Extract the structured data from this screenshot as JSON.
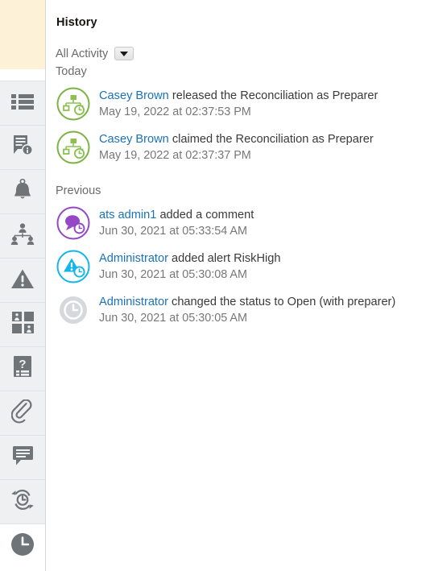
{
  "rail": {
    "items": [
      {
        "name": "properties-list",
        "icon": "list-icon",
        "active": false
      },
      {
        "name": "instructions",
        "icon": "document-info-icon",
        "active": false
      },
      {
        "name": "alerts-bell",
        "icon": "bell-icon",
        "active": false
      },
      {
        "name": "workflow-users",
        "icon": "org-chart-icon",
        "active": false
      },
      {
        "name": "warnings",
        "icon": "warning-triangle-icon",
        "active": false
      },
      {
        "name": "viewers",
        "icon": "people-grid-icon",
        "active": false
      },
      {
        "name": "questions",
        "icon": "question-document-icon",
        "active": false
      },
      {
        "name": "attachments",
        "icon": "paperclip-icon",
        "active": false
      },
      {
        "name": "comments",
        "icon": "speech-bubble-icon",
        "active": false
      },
      {
        "name": "reassign",
        "icon": "refresh-clock-icon",
        "active": false
      },
      {
        "name": "history",
        "icon": "clock-icon",
        "active": true
      }
    ]
  },
  "panel": {
    "title": "History",
    "filter": {
      "label": "All Activity",
      "dropdown_icon": "caret-down-icon"
    },
    "groups": [
      {
        "header": "Today",
        "entries": [
          {
            "icon": "workflow-release-icon",
            "icon_color": "#7cb342",
            "actor": "Casey Brown",
            "action": "released the Reconciliation as Preparer",
            "timestamp": "May 19, 2022 at 02:37:53 PM"
          },
          {
            "icon": "workflow-claim-icon",
            "icon_color": "#7cb342",
            "actor": "Casey Brown",
            "action": "claimed the Reconciliation as Preparer",
            "timestamp": "May 19, 2022 at 02:37:37 PM"
          }
        ]
      },
      {
        "header": "Previous",
        "entries": [
          {
            "icon": "comment-added-icon",
            "icon_color": "#9448c8",
            "actor": "ats admin1",
            "action": "added a comment",
            "timestamp": "Jun 30, 2021 at 05:33:54 AM"
          },
          {
            "icon": "alert-added-icon",
            "icon_color": "#12b6ec",
            "actor": "Administrator",
            "action": "added alert RiskHigh",
            "timestamp": "Jun 30, 2021 at 05:30:08 AM"
          },
          {
            "icon": "status-change-clock-icon",
            "icon_color": "#b8bcbf",
            "actor": "Administrator",
            "action": "changed the status to Open (with preparer)",
            "timestamp": "Jun 30, 2021 at 05:30:05 AM"
          }
        ]
      }
    ]
  },
  "colors": {
    "link": "#1a72bb",
    "muted_text": "#6b6b6b",
    "rail_bg": "#eff0f1",
    "rail_top_panel": "#fdf2d7",
    "icon_gray": "#6e7478"
  }
}
